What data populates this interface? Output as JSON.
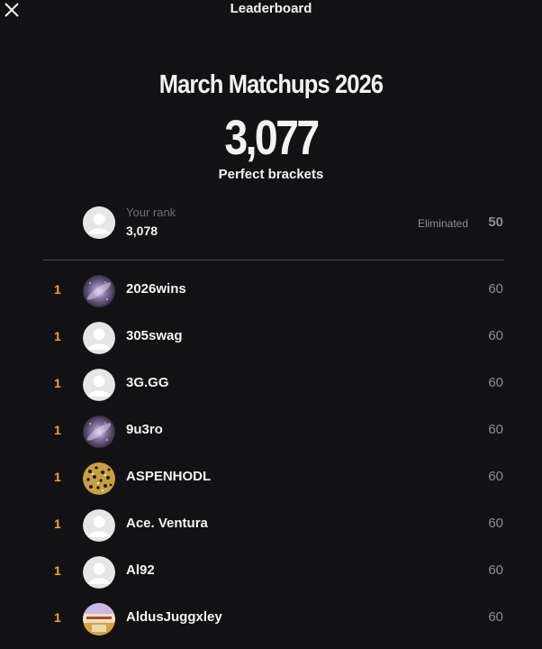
{
  "header": {
    "title": "Leaderboard",
    "close_icon": "close-icon"
  },
  "contest": {
    "title": "March Matchups 2026",
    "count": "3,077",
    "count_label": "Perfect brackets"
  },
  "my_rank": {
    "label": "Your rank",
    "rank": "3,078",
    "status": "Eliminated",
    "score": "50",
    "avatar": "default-avatar"
  },
  "colors": {
    "background": "#121214",
    "rank_accent": "#f0a623",
    "muted_text": "#8e8e93"
  },
  "leaderboard": [
    {
      "rank": "1",
      "name": "2026wins",
      "score": "60",
      "avatar": "galaxy-avatar"
    },
    {
      "rank": "1",
      "name": "305swag",
      "score": "60",
      "avatar": "default-avatar"
    },
    {
      "rank": "1",
      "name": "3G.GG",
      "score": "60",
      "avatar": "default-avatar"
    },
    {
      "rank": "1",
      "name": "9u3ro",
      "score": "60",
      "avatar": "galaxy-avatar"
    },
    {
      "rank": "1",
      "name": "ASPENHODL",
      "score": "60",
      "avatar": "pattern-avatar"
    },
    {
      "rank": "1",
      "name": "Ace. Ventura",
      "score": "60",
      "avatar": "default-avatar"
    },
    {
      "rank": "1",
      "name": "Al92",
      "score": "60",
      "avatar": "default-avatar"
    },
    {
      "rank": "1",
      "name": "AldusJuggxley",
      "score": "60",
      "avatar": "photo-avatar"
    }
  ]
}
